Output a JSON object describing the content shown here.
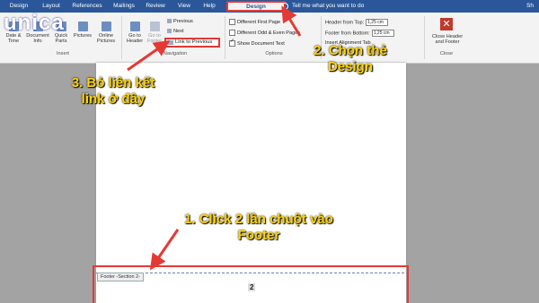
{
  "logo": {
    "text": "unica"
  },
  "tabs": [
    "Design",
    "Layout",
    "References",
    "Mailings",
    "Review",
    "View",
    "Help",
    "Design"
  ],
  "tell_me": "Tell me what you want to do",
  "user_initials": "Sh",
  "ribbon": {
    "insert_group": {
      "date_time": "Date & Time",
      "document_info": "Document Info",
      "quick_parts": "Quick Parts",
      "pictures": "Pictures",
      "online_pictures": "Online Pictures",
      "label": "Insert"
    },
    "navigation_group": {
      "go_to_header": "Go to Header",
      "go_to_footer": "Go to Footer",
      "previous": "Previous",
      "next": "Next",
      "link_to_previous": "Link to Previous",
      "label": "Navigation"
    },
    "options_group": {
      "different_first_page": "Different First Page",
      "different_odd_even": "Different Odd & Even Pages",
      "show_document_text": "Show Document Text",
      "label": "Options"
    },
    "position_group": {
      "header_from_top_label": "Header from Top:",
      "header_from_top_value": "1,25 cm",
      "footer_from_bottom_label": "Footer from Bottom:",
      "footer_from_bottom_value": "1,25 cm",
      "insert_alignment_tab": "Insert Alignment Tab"
    },
    "close_group": {
      "close_button": "Close Header and Footer",
      "label": "Close"
    }
  },
  "document": {
    "footer_tag": "Footer -Section 2-",
    "page_number": "2"
  },
  "annotations": {
    "step1": "1. Click 2 lần chuột vào Footer",
    "step2": "2. Chọn thẻ Design",
    "step3": "3. Bỏ liên kết link ở đây"
  },
  "colors": {
    "tab_bar": "#2b579a",
    "highlight": "#e53935",
    "annotation": "#ffd400",
    "document_bg": "#a3a3a3"
  }
}
